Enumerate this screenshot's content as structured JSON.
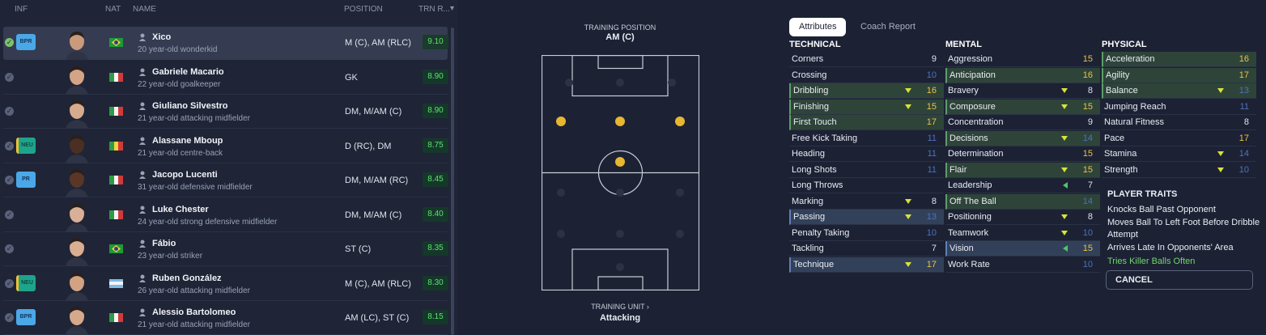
{
  "columns": {
    "inf": "INF",
    "nat": "NAT",
    "name": "NAME",
    "position": "POSITION",
    "trn": "TRN R..."
  },
  "players": [
    {
      "name": "Xico",
      "desc": "20 year-old wonderkid",
      "pos": "M (C), AM (RLC)",
      "rating": "9.10",
      "badge": "BPR",
      "badge_type": "blue",
      "flag": "br",
      "selected": true,
      "skin": "#c99a7c"
    },
    {
      "name": "Gabriele Macario",
      "desc": "22 year-old goalkeeper",
      "pos": "GK",
      "rating": "8.90",
      "badge": "",
      "badge_type": "",
      "flag": "it",
      "selected": false,
      "skin": "#d3a486"
    },
    {
      "name": "Giuliano Silvestro",
      "desc": "21 year-old attacking midfielder",
      "pos": "DM, M/AM (C)",
      "rating": "8.90",
      "badge": "",
      "badge_type": "",
      "flag": "it",
      "selected": false,
      "skin": "#d6ab8e"
    },
    {
      "name": "Alassane Mboup",
      "desc": "21 year-old centre-back",
      "pos": "D (RC), DM",
      "rating": "8.75",
      "badge": "NEU",
      "badge_type": "teal",
      "flag": "sn",
      "selected": false,
      "skin": "#4a2f22"
    },
    {
      "name": "Jacopo Lucenti",
      "desc": "31 year-old defensive midfielder",
      "pos": "DM, M/AM (RC)",
      "rating": "8.45",
      "badge": "PR",
      "badge_type": "blue",
      "flag": "it",
      "selected": false,
      "skin": "#5a3626"
    },
    {
      "name": "Luke Chester",
      "desc": "24 year-old strong defensive midfielder",
      "pos": "DM, M/AM (C)",
      "rating": "8.40",
      "badge": "",
      "badge_type": "",
      "flag": "it",
      "selected": false,
      "skin": "#d8b097"
    },
    {
      "name": "Fábio",
      "desc": "23 year-old striker",
      "pos": "ST (C)",
      "rating": "8.35",
      "badge": "",
      "badge_type": "",
      "flag": "br",
      "selected": false,
      "skin": "#d9ae92"
    },
    {
      "name": "Ruben González",
      "desc": "26 year-old attacking midfielder",
      "pos": "M (C), AM (RLC)",
      "rating": "8.30",
      "badge": "NEU",
      "badge_type": "teal",
      "flag": "ar",
      "selected": false,
      "skin": "#d2a283"
    },
    {
      "name": "Alessio Bartolomeo",
      "desc": "21 year-old attacking midfielder",
      "pos": "AM (LC), ST (C)",
      "rating": "8.15",
      "badge": "BPR",
      "badge_type": "blue",
      "flag": "it",
      "selected": false,
      "skin": "#d5a98b"
    }
  ],
  "training": {
    "position_label": "TRAINING POSITION",
    "position_value": "AM (C)",
    "unit_label": "TRAINING UNIT ›",
    "unit_value": "Attacking"
  },
  "tabs": {
    "attributes": "Attributes",
    "coach": "Coach Report"
  },
  "headers": {
    "technical": "TECHNICAL",
    "mental": "MENTAL",
    "physical": "PHYSICAL",
    "traits": "PLAYER TRAITS"
  },
  "technical": [
    {
      "name": "Corners",
      "value": "9",
      "vc": "w",
      "hl": "",
      "arrow": ""
    },
    {
      "name": "Crossing",
      "value": "10",
      "vc": "b",
      "hl": "",
      "arrow": ""
    },
    {
      "name": "Dribbling",
      "value": "16",
      "vc": "y",
      "hl": "g",
      "arrow": "y"
    },
    {
      "name": "Finishing",
      "value": "15",
      "vc": "y",
      "hl": "g",
      "arrow": "y"
    },
    {
      "name": "First Touch",
      "value": "17",
      "vc": "y",
      "hl": "g",
      "arrow": ""
    },
    {
      "name": "Free Kick Taking",
      "value": "11",
      "vc": "b",
      "hl": "",
      "arrow": ""
    },
    {
      "name": "Heading",
      "value": "11",
      "vc": "b",
      "hl": "",
      "arrow": ""
    },
    {
      "name": "Long Shots",
      "value": "11",
      "vc": "b",
      "hl": "",
      "arrow": ""
    },
    {
      "name": "Long Throws",
      "value": "",
      "vc": "w",
      "hl": "",
      "arrow": ""
    },
    {
      "name": "Marking",
      "value": "8",
      "vc": "w",
      "hl": "",
      "arrow": "y"
    },
    {
      "name": "Passing",
      "value": "13",
      "vc": "b",
      "hl": "b",
      "arrow": "y"
    },
    {
      "name": "Penalty Taking",
      "value": "10",
      "vc": "b",
      "hl": "",
      "arrow": ""
    },
    {
      "name": "Tackling",
      "value": "7",
      "vc": "w",
      "hl": "",
      "arrow": ""
    },
    {
      "name": "Technique",
      "value": "17",
      "vc": "y",
      "hl": "b",
      "arrow": "y"
    }
  ],
  "mental": [
    {
      "name": "Aggression",
      "value": "15",
      "vc": "y",
      "hl": "",
      "arrow": ""
    },
    {
      "name": "Anticipation",
      "value": "16",
      "vc": "y",
      "hl": "g",
      "arrow": ""
    },
    {
      "name": "Bravery",
      "value": "8",
      "vc": "w",
      "hl": "",
      "arrow": "y"
    },
    {
      "name": "Composure",
      "value": "15",
      "vc": "y",
      "hl": "g",
      "arrow": "y"
    },
    {
      "name": "Concentration",
      "value": "9",
      "vc": "w",
      "hl": "",
      "arrow": ""
    },
    {
      "name": "Decisions",
      "value": "14",
      "vc": "b",
      "hl": "g",
      "arrow": "y"
    },
    {
      "name": "Determination",
      "value": "15",
      "vc": "y",
      "hl": "",
      "arrow": ""
    },
    {
      "name": "Flair",
      "value": "15",
      "vc": "y",
      "hl": "g",
      "arrow": "y"
    },
    {
      "name": "Leadership",
      "value": "7",
      "vc": "w",
      "hl": "",
      "arrow": "g"
    },
    {
      "name": "Off The Ball",
      "value": "14",
      "vc": "b",
      "hl": "g",
      "arrow": ""
    },
    {
      "name": "Positioning",
      "value": "8",
      "vc": "w",
      "hl": "",
      "arrow": "y"
    },
    {
      "name": "Teamwork",
      "value": "10",
      "vc": "b",
      "hl": "",
      "arrow": "y"
    },
    {
      "name": "Vision",
      "value": "15",
      "vc": "y",
      "hl": "b",
      "arrow": "g"
    },
    {
      "name": "Work Rate",
      "value": "10",
      "vc": "b",
      "hl": "",
      "arrow": ""
    }
  ],
  "physical": [
    {
      "name": "Acceleration",
      "value": "16",
      "vc": "y",
      "hl": "g",
      "arrow": ""
    },
    {
      "name": "Agility",
      "value": "17",
      "vc": "y",
      "hl": "g",
      "arrow": ""
    },
    {
      "name": "Balance",
      "value": "13",
      "vc": "b",
      "hl": "g",
      "arrow": "y"
    },
    {
      "name": "Jumping Reach",
      "value": "11",
      "vc": "b",
      "hl": "",
      "arrow": ""
    },
    {
      "name": "Natural Fitness",
      "value": "8",
      "vc": "w",
      "hl": "",
      "arrow": ""
    },
    {
      "name": "Pace",
      "value": "17",
      "vc": "y",
      "hl": "",
      "arrow": ""
    },
    {
      "name": "Stamina",
      "value": "14",
      "vc": "b",
      "hl": "",
      "arrow": "y"
    },
    {
      "name": "Strength",
      "value": "10",
      "vc": "b",
      "hl": "",
      "arrow": "y"
    }
  ],
  "traits": [
    {
      "text": "Knocks Ball Past Opponent",
      "new": false
    },
    {
      "text": "Moves Ball To Left Foot Before Dribble Attempt",
      "new": false
    },
    {
      "text": "Arrives Late In Opponents' Area",
      "new": false
    },
    {
      "text": "Tries Killer Balls Often",
      "new": true
    }
  ],
  "cancel_label": "CANCEL",
  "colors": {
    "yellow": "#ecc24a",
    "blue": "#4d72c0",
    "green": "#5fe070"
  }
}
